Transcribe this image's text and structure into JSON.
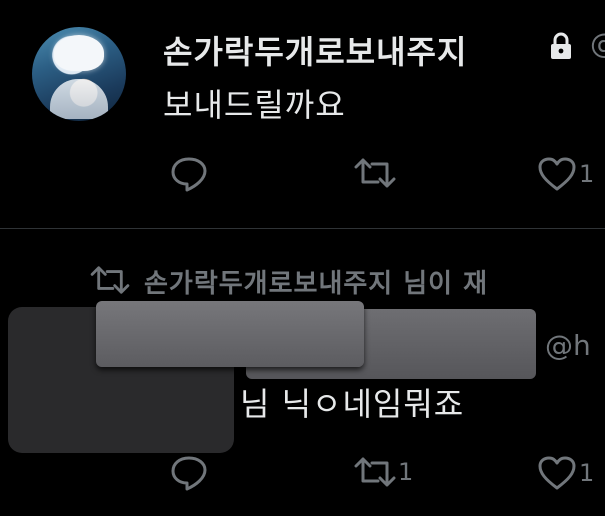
{
  "tweet1": {
    "display_name": "손가락두개로보내주지",
    "handle_fragment": "@",
    "text": "보내드릴까요",
    "actions": {
      "reply_count": "",
      "retweet_count": "",
      "like_count": "1"
    }
  },
  "tweet2": {
    "retweet_label": "손가락두개로보내주지 님이 재",
    "handle_fragment": "@h",
    "text": "님 닉ㅇ네임뭐죠",
    "actions": {
      "reply_count": "",
      "retweet_count": "1",
      "like_count": "1"
    }
  },
  "icons": {
    "lock": "lock-icon",
    "reply": "reply-icon",
    "retweet": "retweet-icon",
    "like": "heart-icon"
  },
  "colors": {
    "background": "#000000",
    "text_primary": "#e7e9ea",
    "text_secondary": "#71767b",
    "divider": "#2f3336"
  }
}
